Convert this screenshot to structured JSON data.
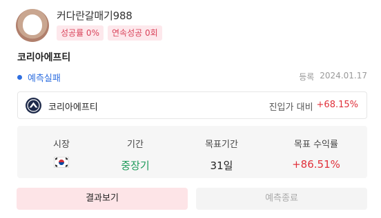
{
  "profile": {
    "username": "커다란갈매기988",
    "badges": [
      "성공률 0%",
      "연속성공 0회"
    ]
  },
  "stock": {
    "title": "코리아에프티",
    "name": "코리아에프티"
  },
  "status": {
    "text": "예측실패",
    "color": "#2f6fe0"
  },
  "registration": {
    "label": "등록",
    "date": "2024.01.17"
  },
  "entry": {
    "label": "진입가 대비",
    "value": "+68.15%"
  },
  "stats": {
    "market": {
      "header": "시장",
      "flag": "south-korea-flag-icon"
    },
    "period": {
      "header": "기간",
      "value": "중장기"
    },
    "target_period": {
      "header": "목표기간",
      "value": "31일"
    },
    "target_return": {
      "header": "목표 수익률",
      "value": "+86.51%"
    }
  },
  "buttons": {
    "result": "결과보기",
    "end": "예측종료"
  },
  "colors": {
    "badge_text": "#d9435a",
    "badge_bg": "#fde8ec",
    "positive": "#e0303a",
    "period": "#1d9a5a"
  }
}
